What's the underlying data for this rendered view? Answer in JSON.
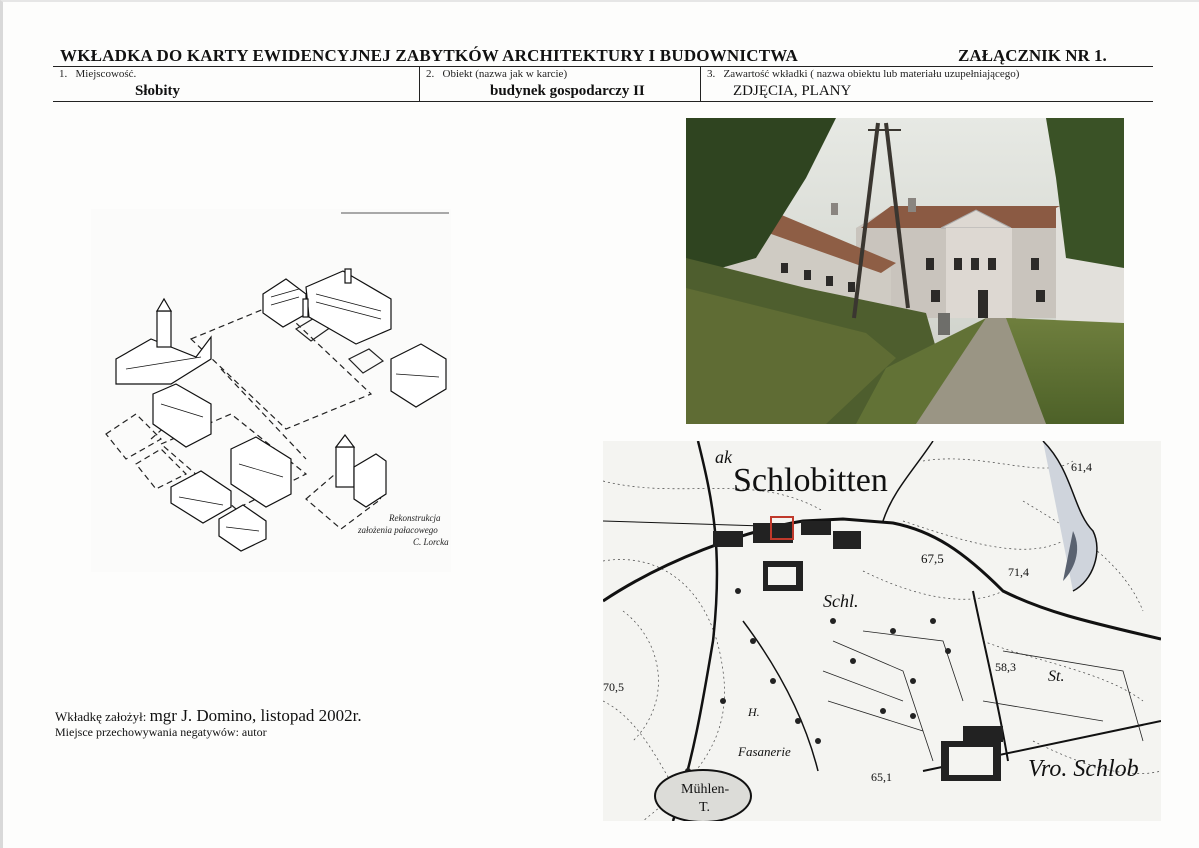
{
  "header": {
    "title": "WKŁADKA DO KARTY EWIDENCYJNEJ ZABYTKÓW ARCHITEKTURY I BUDOWNICTWA",
    "annex": "ZAŁĄCZNIK NR 1."
  },
  "fields": [
    {
      "number": "1.",
      "label": "Miejscowość.",
      "value": "Słobity"
    },
    {
      "number": "2.",
      "label": "Obiekt (nazwa jak w karcie)",
      "value": "budynek gospodarczy II"
    },
    {
      "number": "3.",
      "label": "Zawartość wkładki ( nazwa obiektu lub materiału uzupełniającego)",
      "value": "ZDJĘCIA, PLANY"
    }
  ],
  "sketch": {
    "caption_line1": "Rekonstrukcja",
    "caption_line2": "założenia pałacowego",
    "caption_line3": "C. Lorcka"
  },
  "map": {
    "place": "Schlobitten",
    "label_schl": "Schl.",
    "label_fasanerie": "Fasanerie",
    "label_muhlen": "Mühlen-",
    "label_t": "T.",
    "label_vro": "Vro. Schlob",
    "label_st": "St.",
    "label_h": "H.",
    "label_ak": "ak",
    "elevations": [
      "61,4",
      "67,5",
      "71,4",
      "58,3",
      "70,5",
      "65,1"
    ]
  },
  "footer": {
    "author_prefix": "Wkładkę założył:",
    "author_value": "mgr J. Domino, listopad 2002r.",
    "negatives": "Miejsce przechowywania negatywów: autor"
  }
}
